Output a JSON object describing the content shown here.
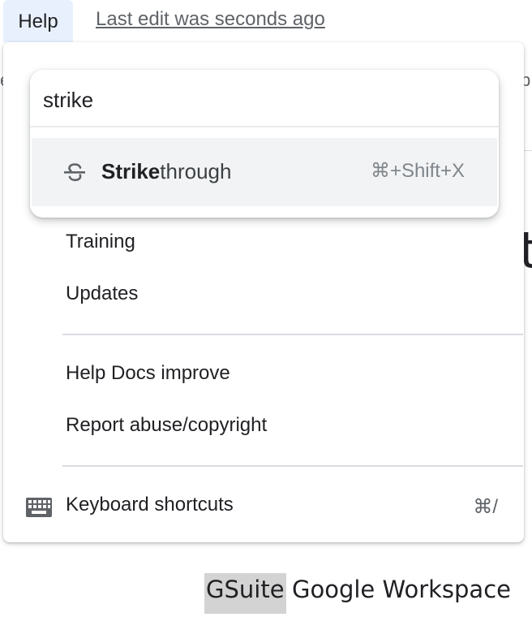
{
  "menubar": {
    "help_label": "Help",
    "last_edit": "Last edit was seconds ago"
  },
  "search": {
    "query": "strike",
    "result": {
      "match": "Strike",
      "rest": "through",
      "shortcut": "⌘+Shift+X",
      "icon": "strikethrough-icon"
    }
  },
  "help_menu": {
    "items": [
      {
        "label": "Training"
      },
      {
        "label": "Updates"
      },
      {
        "label": "Help Docs improve"
      },
      {
        "label": "Report abuse/copyright"
      },
      {
        "label": "Keyboard shortcuts",
        "shortcut": "⌘/",
        "icon": "keyboard-icon"
      }
    ]
  },
  "document": {
    "highlighted_text": "GSuite",
    "following_text": "Google Workspace",
    "left_fragment": "e",
    "right_fragment": "p",
    "big_glyph": "t"
  },
  "colors": {
    "menu_active_bg": "#e8f0fe",
    "result_hover_bg": "#f1f3f4",
    "highlight_bg": "#d3d3d3",
    "divider": "#dadce0"
  }
}
